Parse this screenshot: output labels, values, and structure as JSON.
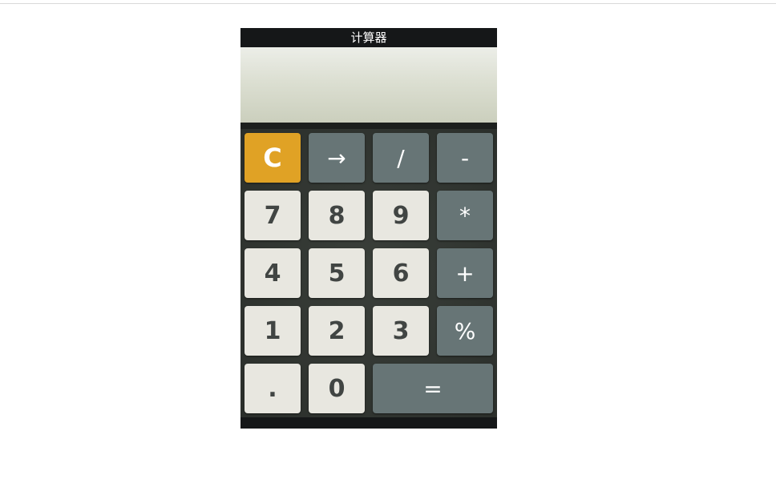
{
  "calculator": {
    "title": "计算器",
    "display_value": ""
  },
  "keys": {
    "clear": "C",
    "backspace": "→",
    "divide": "/",
    "subtract": "-",
    "seven": "7",
    "eight": "8",
    "nine": "9",
    "multiply": "*",
    "four": "4",
    "five": "5",
    "six": "6",
    "add": "+",
    "one": "1",
    "two": "2",
    "three": "3",
    "percent": "%",
    "decimal": ".",
    "zero": "0",
    "equals": "="
  },
  "colors": {
    "title_bar": "#151718",
    "clear_key": "#e0a225",
    "operator_key": "#677576",
    "number_key": "#e8e7e0",
    "number_text": "#414543",
    "display_top": "#eceee8",
    "display_bottom": "#cbcfbd"
  }
}
